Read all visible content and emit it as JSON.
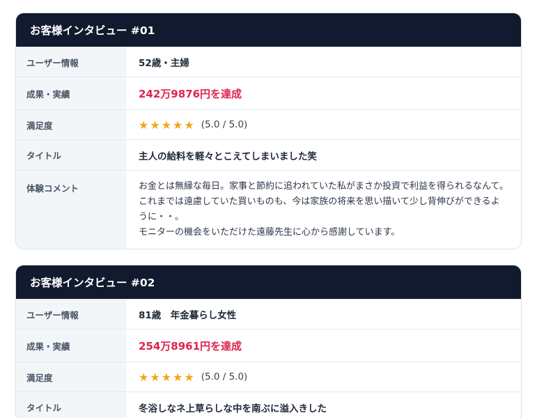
{
  "interviews": [
    {
      "heading": "お客様インタビュー #01",
      "labels": {
        "user": "ユーザー情報",
        "result": "成果・実績",
        "satisfaction": "満足度",
        "title": "タイトル",
        "comment": "体験コメント"
      },
      "user_info": "52歳・主婦",
      "result": "242万9876円を達成",
      "stars": "★★★★★",
      "rating": 5.0,
      "score_text": "(5.0 / 5.0)",
      "title": "主人の給料を軽々とこえてしまいました笑",
      "comment_lines": [
        "お金とは無縁な毎日。家事と節約に追われていた私がまさか投資で利益を得られるなんて。",
        "これまでは遠慮していた買いものも、今は家族の将来を思い描いて少し背伸びができるように・・。",
        "モニターの機会をいただけた遠藤先生に心から感謝しています。"
      ]
    },
    {
      "heading": "お客様インタビュー #02",
      "labels": {
        "user": "ユーザー情報",
        "result": "成果・実績",
        "satisfaction": "満足度",
        "title": "タイトル"
      },
      "user_info": "81歳　年金暮らし女性",
      "result": "254万8961円を達成",
      "stars": "★★★★★",
      "rating": 5.0,
      "score_text": "(5.0 / 5.0)",
      "title": "冬浴しなネ上草らしな中を南ぶに溢入きした"
    }
  ]
}
